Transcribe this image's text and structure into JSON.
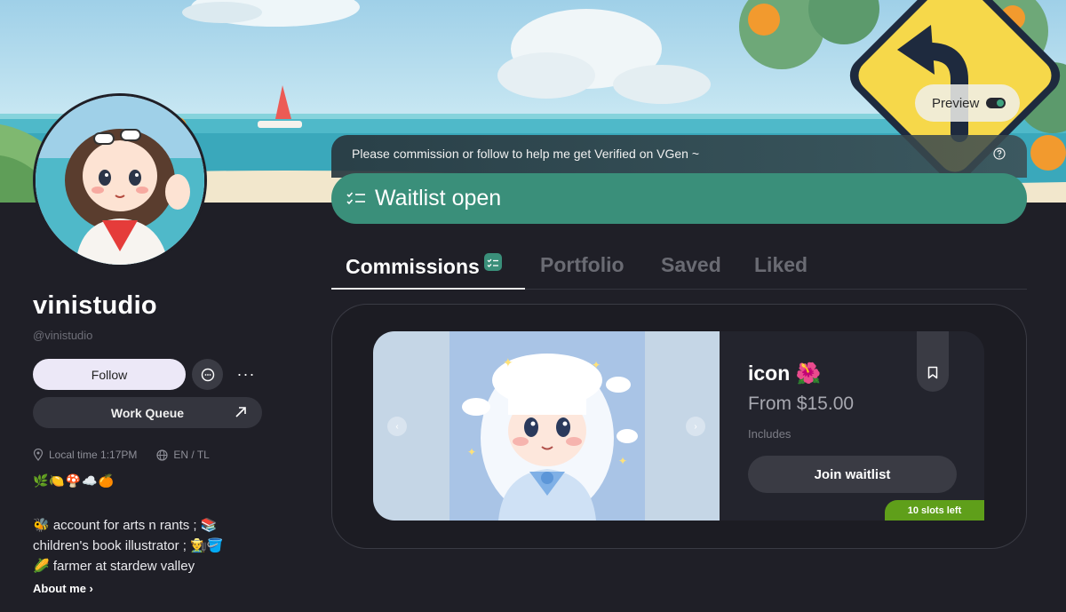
{
  "banner": {
    "preview_label": "Preview",
    "preview_on": true
  },
  "profile": {
    "username": "vinistudio",
    "handle": "@vinistudio",
    "follow_label": "Follow",
    "more_label": "···",
    "work_queue_label": "Work Queue",
    "local_time": "Local time 1:17PM",
    "languages": "EN / TL",
    "emoji_line": "🌿🍋🍄☁️🍊",
    "bio_lines": [
      "🐝 account for arts n rants ; 📚",
      "children's book illustrator ; 👨‍🌾🪣",
      "🌽 farmer at stardew valley"
    ],
    "about_label": "About me ›"
  },
  "notice": {
    "text": "Please commission or follow to help me get Verified on VGen ~",
    "waitlist_label": "Waitlist open"
  },
  "tabs": [
    {
      "label": "Commissions",
      "active": true
    },
    {
      "label": "Portfolio",
      "active": false
    },
    {
      "label": "Saved",
      "active": false
    },
    {
      "label": "Liked",
      "active": false
    }
  ],
  "commission": {
    "title": "icon 🌺",
    "price": "From $15.00",
    "includes_label": "Includes",
    "join_label": "Join waitlist",
    "slots_label": "10 slots left",
    "prev_label": "‹",
    "next_label": "›"
  },
  "colors": {
    "accent": "#3a8f7a",
    "slots": "#5f9f1a",
    "background": "#1f1f27"
  }
}
